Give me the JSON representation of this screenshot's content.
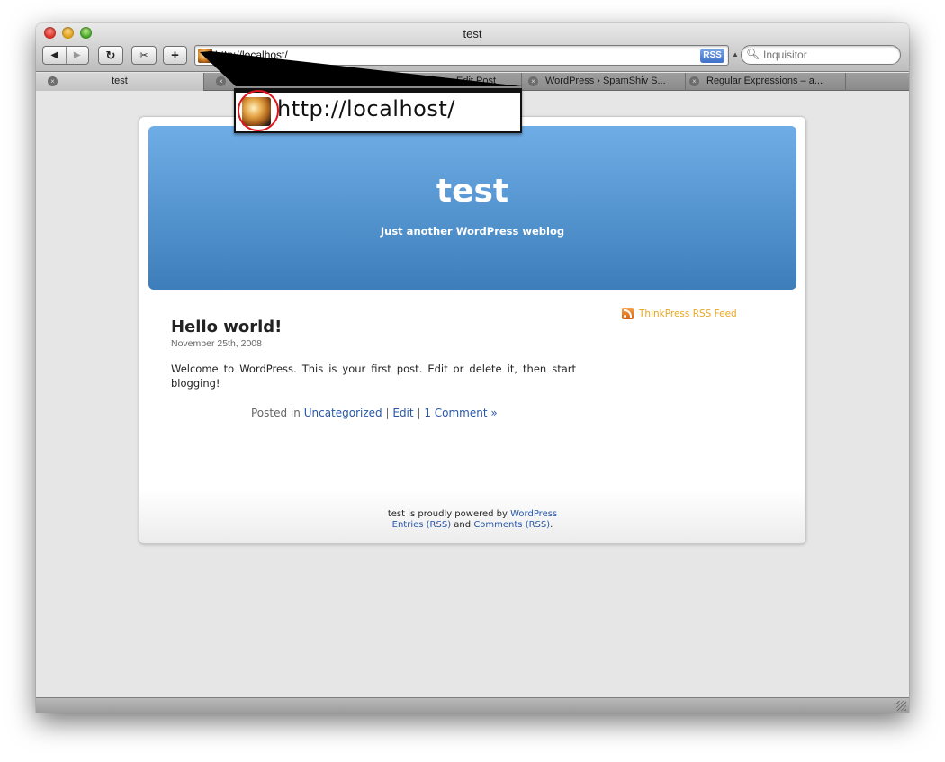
{
  "window": {
    "title": "test"
  },
  "toolbar": {
    "back": "◀",
    "forward": "▶",
    "reload": "↻",
    "snip": "✂",
    "add": "+",
    "url": "http://localhost/",
    "rss_badge": "RSS",
    "search_placeholder": "Inquisitor"
  },
  "tabs": [
    {
      "label": "test",
      "active": true
    },
    {
      "label": "Edit Post",
      "active": false
    },
    {
      "label": "WordPress › SpamShiv S...",
      "active": false
    },
    {
      "label": "Regular Expressions – a...",
      "active": false
    }
  ],
  "blog": {
    "title": "test",
    "tagline": "Just another WordPress weblog"
  },
  "post": {
    "title": "Hello world!",
    "date": "November 25th, 2008",
    "body": "Welcome to WordPress. This is your first post. Edit or delete it, then start blogging!",
    "posted_in": "Posted in",
    "category": "Uncategorized",
    "sep": "|",
    "edit": "Edit",
    "comments": "1 Comment »"
  },
  "sidebar": {
    "rss_feed": "ThinkPress RSS Feed"
  },
  "footer": {
    "powered_prefix": "test is proudly powered by",
    "wordpress": "WordPress",
    "entries": "Entries (RSS)",
    "and": "and",
    "comments": "Comments (RSS)",
    "period": "."
  },
  "zoom": {
    "url": "http://localhost/"
  },
  "colors": {
    "header_top": "#6fade6",
    "header_bottom": "#3d7eba",
    "link": "#2557a8",
    "rss_feed": "#e8a722",
    "callout_circle": "#e0141a"
  }
}
